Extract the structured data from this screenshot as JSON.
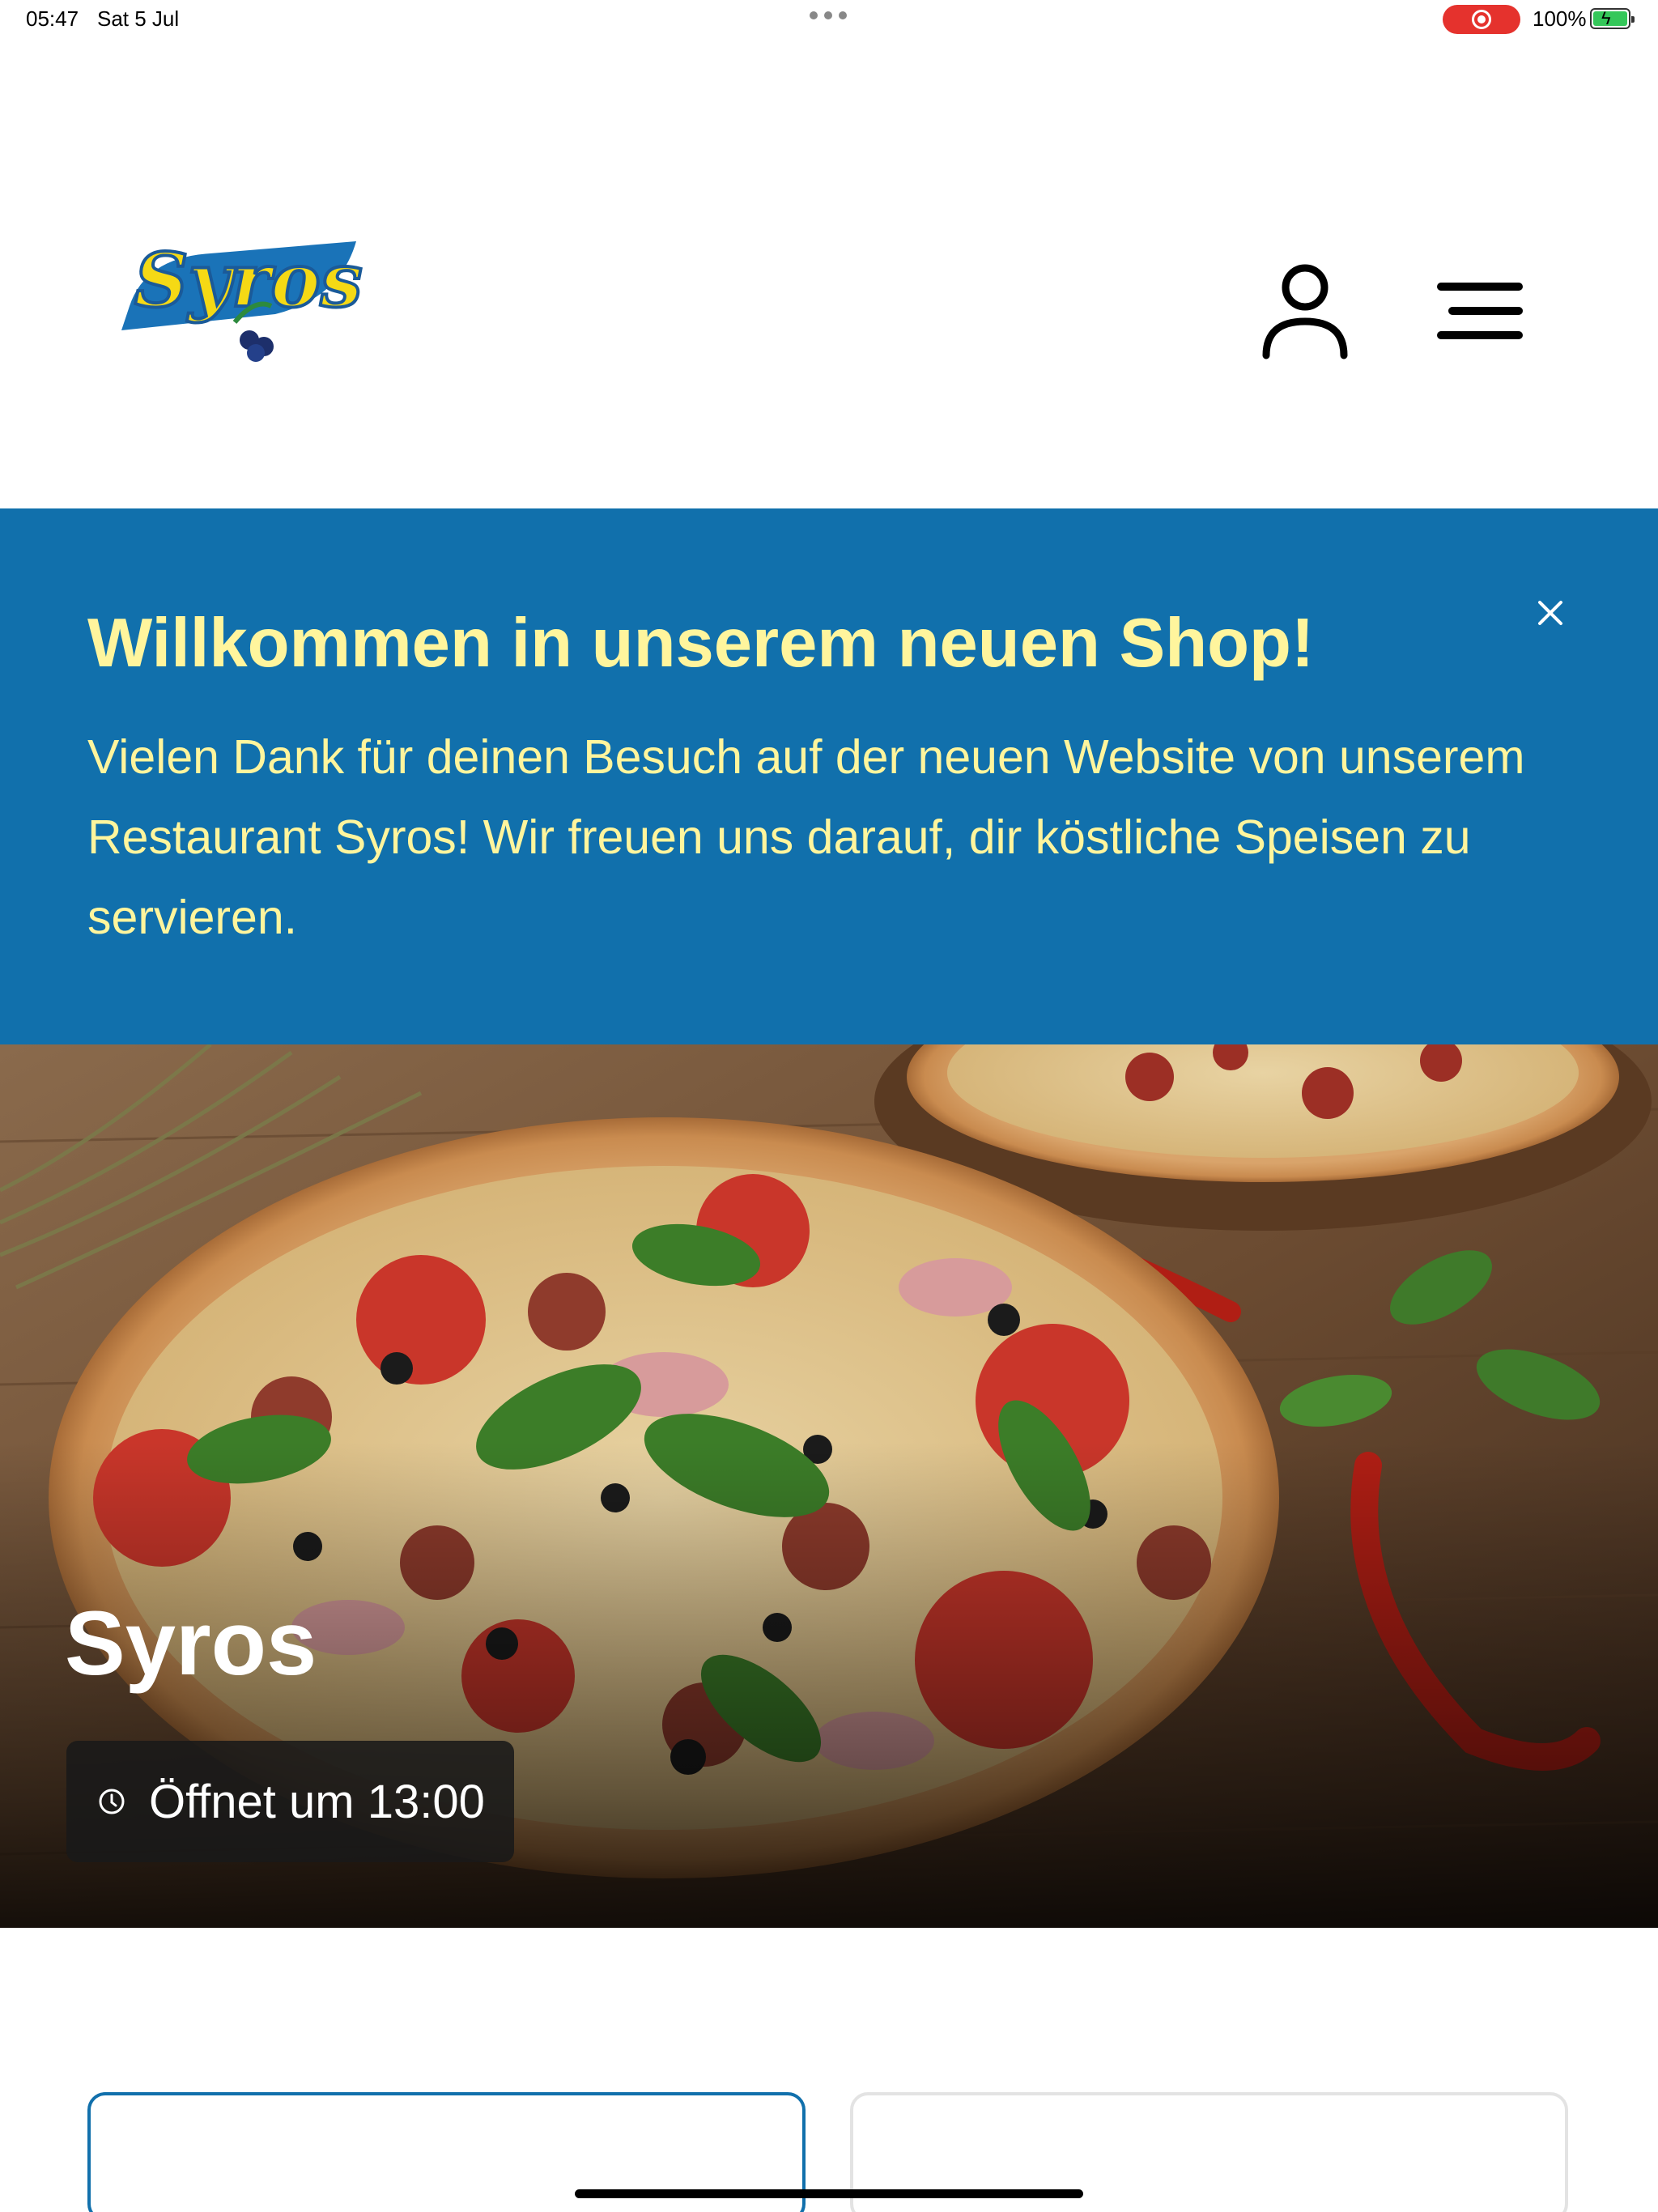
{
  "status_bar": {
    "time": "05:47",
    "date": "Sat 5 Jul",
    "battery": "100%"
  },
  "header": {
    "logo_text": "Syros",
    "icons": [
      "account-icon",
      "hamburger-menu-icon"
    ]
  },
  "banner": {
    "title": "Willkommen in unserem neuen Shop!",
    "text": "Vielen Dank für deinen Besuch auf der neuen Website von unserem Restaurant Syros! Wir freuen uns darauf, dir köstliche Speisen zu servieren.",
    "close_icon": "close-icon"
  },
  "hero": {
    "title": "Syros",
    "hours": "Öffnet um 13:00",
    "hours_icon": "clock-icon"
  },
  "colors": {
    "brand_blue": "#1170ac",
    "banner_text": "#fff59d",
    "logo_yellow": "#f5d915"
  }
}
